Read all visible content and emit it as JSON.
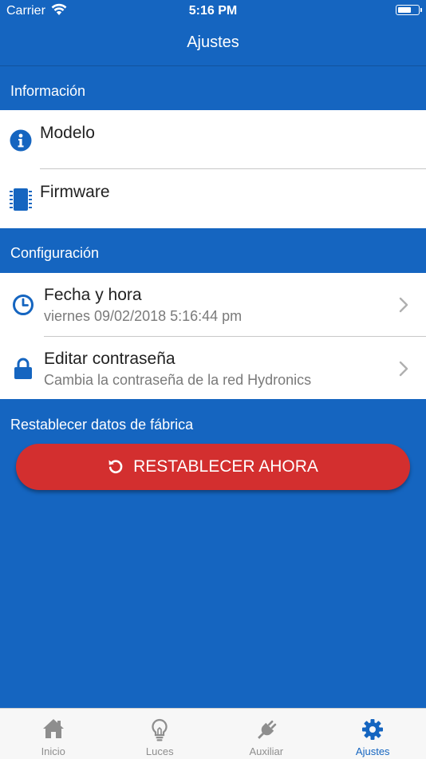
{
  "status_bar": {
    "carrier": "Carrier",
    "time": "5:16 PM",
    "battery_level": 0.7
  },
  "nav": {
    "title": "Ajustes"
  },
  "sections": {
    "informacion": {
      "header": "Información",
      "rows": [
        {
          "title": "Modelo",
          "icon": "info-icon"
        },
        {
          "title": "Firmware",
          "icon": "chip-icon"
        }
      ]
    },
    "configuracion": {
      "header": "Configuración",
      "rows": [
        {
          "title": "Fecha y hora",
          "subtitle": "viernes 09/02/2018 5:16:44 pm",
          "icon": "clock-icon"
        },
        {
          "title": "Editar contraseña",
          "subtitle": "Cambia la contraseña de la red Hydronics",
          "icon": "lock-icon"
        }
      ]
    },
    "reset": {
      "header": "Restablecer datos de fábrica",
      "button_label": "RESTABLECER AHORA",
      "icon": "restore-icon"
    }
  },
  "tab_bar": {
    "tabs": [
      {
        "label": "Inicio",
        "icon": "home-icon",
        "active": false
      },
      {
        "label": "Luces",
        "icon": "lightbulb-icon",
        "active": false
      },
      {
        "label": "Auxiliar",
        "icon": "plug-icon",
        "active": false
      },
      {
        "label": "Ajustes",
        "icon": "gear-icon",
        "active": true
      }
    ]
  },
  "colors": {
    "primary": "#1565c0",
    "danger": "#d32f2f",
    "tab_inactive": "#8e8e8e",
    "subtitle": "#7a7a7a"
  }
}
